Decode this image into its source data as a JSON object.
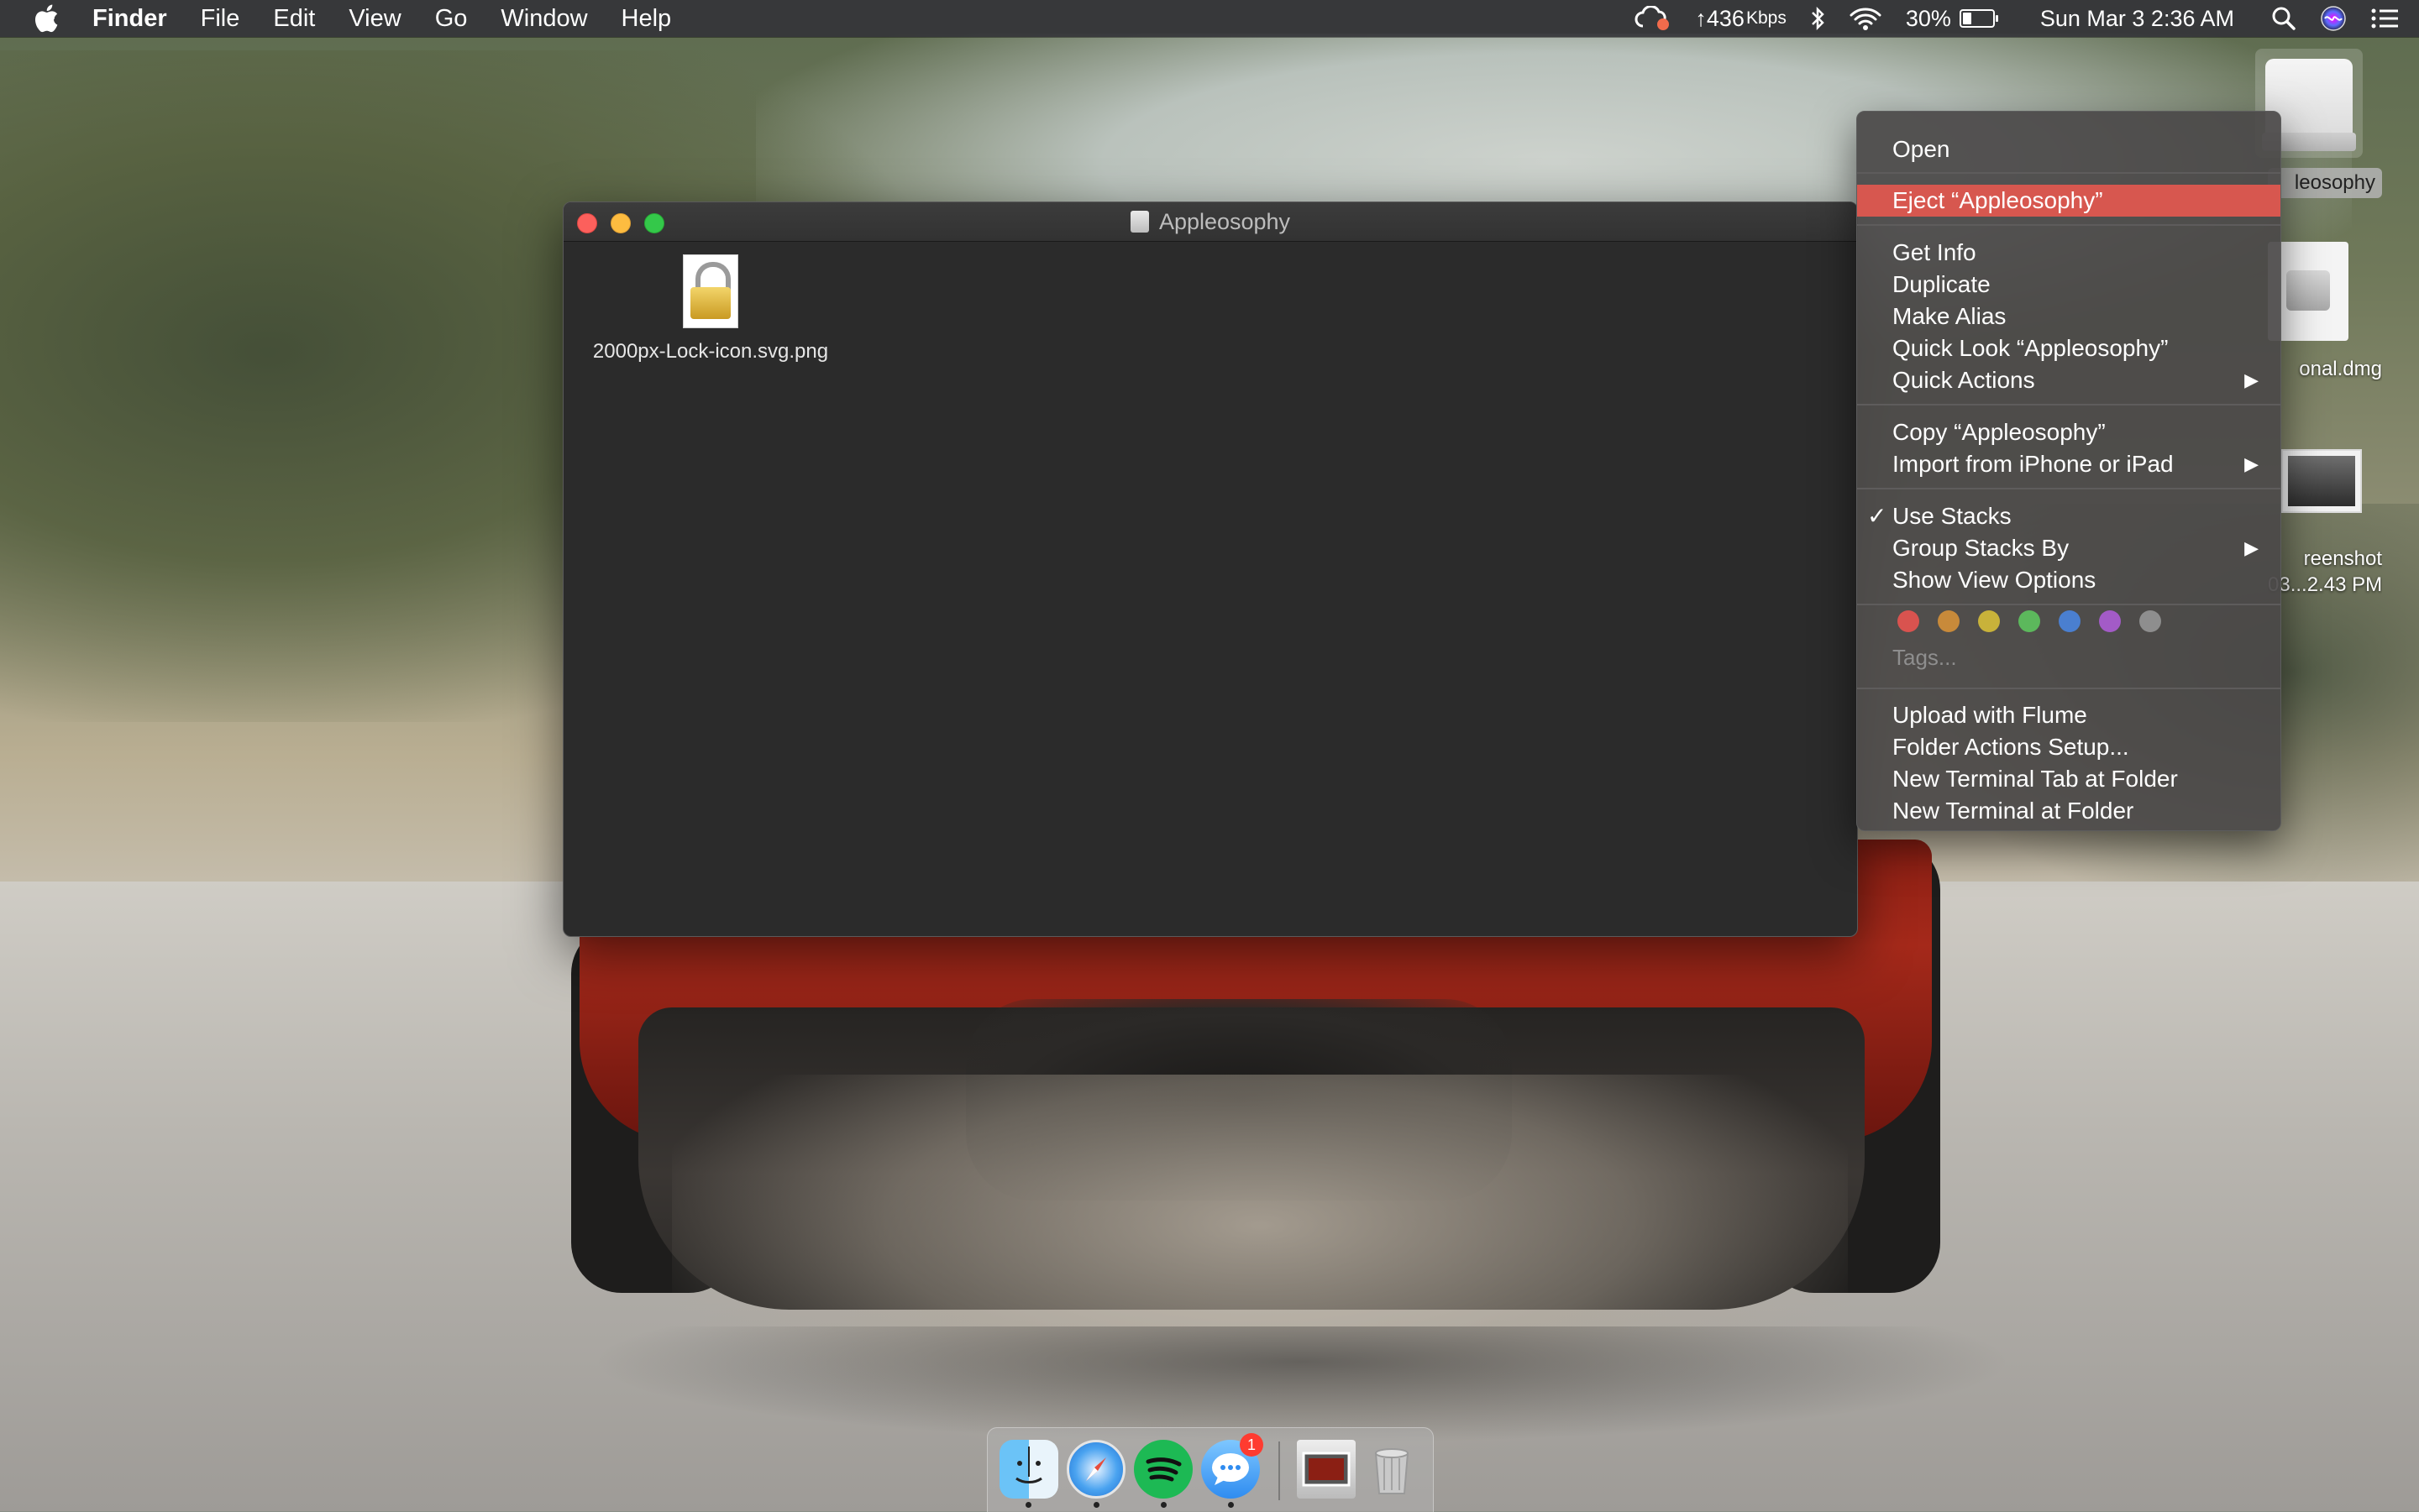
{
  "menubar": {
    "app_name": "Finder",
    "menus": [
      "File",
      "Edit",
      "View",
      "Go",
      "Window",
      "Help"
    ],
    "network_speed": "↑436",
    "network_unit": "Kbps",
    "battery_percent": "30%",
    "battery_level": 0.3,
    "clock": "Sun Mar 3  2:36 AM"
  },
  "desktop": {
    "drive_label": "leosophy",
    "dmg_label": "onal.dmg",
    "screenshot_label_line1": "reenshot",
    "screenshot_label_line2": "03...2.43 PM"
  },
  "finder_window": {
    "title": "Appleosophy",
    "files": [
      {
        "name": "2000px-Lock-icon.svg.png",
        "icon": "lock-icon"
      }
    ]
  },
  "context_menu": {
    "items": {
      "open": "Open",
      "eject": "Eject “Appleosophy”",
      "get_info": "Get Info",
      "duplicate": "Duplicate",
      "make_alias": "Make Alias",
      "quick_look": "Quick Look “Appleosophy”",
      "quick_actions": "Quick Actions",
      "copy": "Copy “Appleosophy”",
      "import_iphone": "Import from iPhone or iPad",
      "use_stacks": "Use Stacks",
      "group_stacks_by": "Group Stacks By",
      "show_view_options": "Show View Options",
      "tags": "Tags...",
      "upload_flume": "Upload with Flume",
      "folder_actions": "Folder Actions Setup...",
      "new_terminal_tab": "New Terminal Tab at Folder",
      "new_terminal": "New Terminal at Folder"
    },
    "submenu_arrow": "▶",
    "checkmark": "✓",
    "highlight_color": "#d7574f",
    "tag_colors": [
      "#d9534f",
      "#c88a3a",
      "#c8b23a",
      "#5cb85c",
      "#4a7fd0",
      "#a35bc7",
      "#8e8e8e"
    ]
  },
  "dock": {
    "apps": [
      "finder-icon",
      "safari-icon",
      "spotify-icon",
      "messages-icon",
      "photos-stack-icon",
      "trash-icon"
    ],
    "messages_badge": "1"
  }
}
